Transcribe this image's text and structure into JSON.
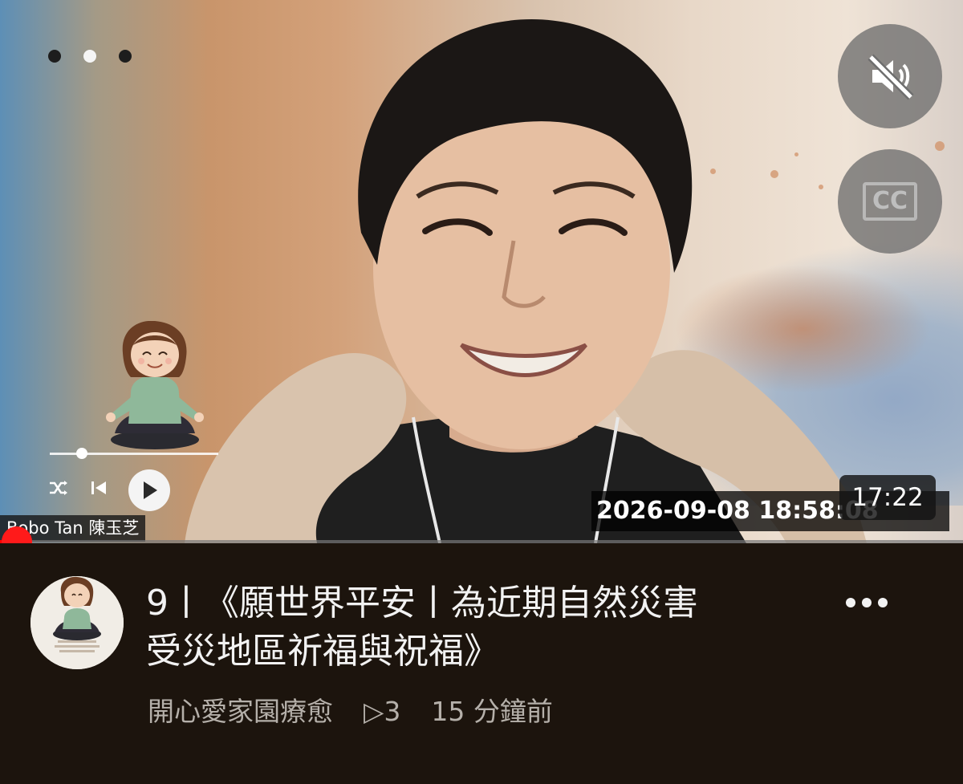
{
  "player": {
    "name_tag": "Bobo Tan 陳玉芝",
    "timestamp": "2026-09-08  18:58:08",
    "duration": "17:22",
    "cc_label": "CC",
    "progress_fraction": 0.03
  },
  "mini_player": {
    "progress_fraction": 0.19
  },
  "video_info": {
    "title_line1": "9丨《願世界平安丨為近期自然災害",
    "title_line2": "受災地區祈福與祝福》",
    "channel": "開心愛家園療愈",
    "views": "▷3",
    "published": "15 分鐘前"
  },
  "icons": [
    "three-dots-icon",
    "mute-icon",
    "cc-icon",
    "shuffle-icon",
    "previous-icon",
    "play-icon",
    "more-vert-icon"
  ],
  "colors": {
    "progress": "#ff0000",
    "info_background": "#1c140d",
    "title_text": "#f2f2f2",
    "meta_text": "#b5b0aa"
  }
}
